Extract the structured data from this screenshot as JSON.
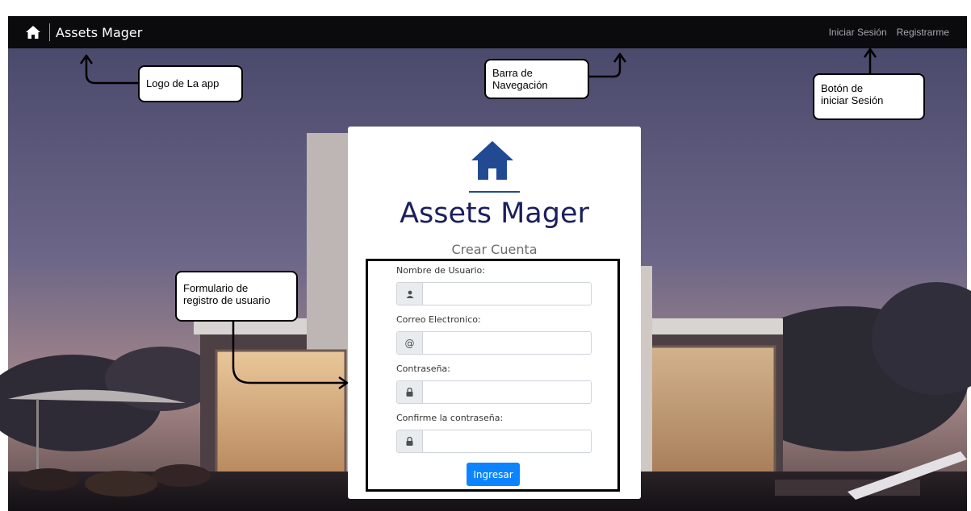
{
  "app": {
    "brand_name": "Assets Mager"
  },
  "navbar": {
    "links": [
      {
        "label": "Iniciar Sesión"
      },
      {
        "label": "Registrarme"
      }
    ]
  },
  "card": {
    "title": "Assets Mager",
    "subtitle": "Crear Cuenta",
    "fields": [
      {
        "label": "Nombre de Usuario:",
        "icon": "user-icon",
        "value": "",
        "placeholder": ""
      },
      {
        "label": "Correo Electronico:",
        "icon": "at-sign-icon",
        "addon_text": "@",
        "value": "",
        "placeholder": ""
      },
      {
        "label": "Contraseña:",
        "icon": "lock-icon",
        "value": "",
        "placeholder": ""
      },
      {
        "label": "Confirme la contraseña:",
        "icon": "lock-icon",
        "value": "",
        "placeholder": ""
      }
    ],
    "submit_label": "Ingresar"
  },
  "annotations": {
    "logo": [
      "Logo de La app"
    ],
    "navbar": [
      "Barra de",
      "Navegación"
    ],
    "login": [
      "Botón de",
      "iniciar Sesión"
    ],
    "form": [
      "Formulario de",
      "registro de usuario"
    ]
  },
  "colors": {
    "navbar_bg": "#0b0b0e",
    "brand_blue": "#214a93",
    "title_color": "#1b1f5c",
    "button_blue": "#0d84ff",
    "sky_top": "#4e4e72",
    "sky_bottom": "#b48a86"
  }
}
